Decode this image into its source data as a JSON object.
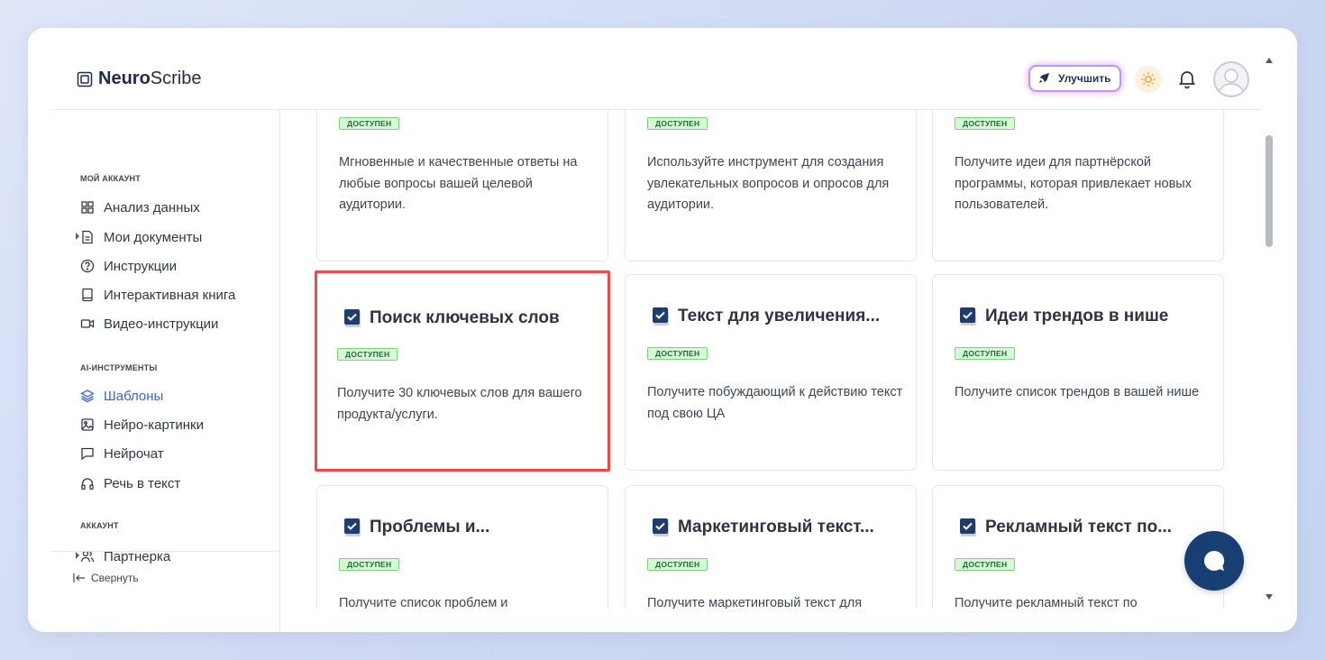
{
  "header": {
    "logo_bold": "Neuro",
    "logo_rest": "Scribe",
    "upgrade_label": "Улучшить"
  },
  "sidebar": {
    "sections": [
      {
        "title": "МОЙ АККАУНТ"
      },
      {
        "title": "AI-ИНСТРУМЕНТЫ"
      },
      {
        "title": "АККАУНТ"
      }
    ],
    "items": [
      {
        "label": "Анализ данных",
        "icon": "grid-icon"
      },
      {
        "label": "Мои документы",
        "icon": "document-icon"
      },
      {
        "label": "Инструкции",
        "icon": "help-circle-icon"
      },
      {
        "label": "Интерактивная книга",
        "icon": "book-icon"
      },
      {
        "label": "Видео-инструкции",
        "icon": "video-icon"
      },
      {
        "label": "Шаблоны",
        "icon": "layers-icon",
        "active": true
      },
      {
        "label": "Нейро-картинки",
        "icon": "image-icon"
      },
      {
        "label": "Нейрочат",
        "icon": "chat-icon"
      },
      {
        "label": "Речь в текст",
        "icon": "headphones-icon"
      },
      {
        "label": "Партнерка",
        "icon": "users-icon"
      }
    ],
    "collapse_label": "Свернуть"
  },
  "cards": [
    {
      "title": "",
      "badge": "ДОСТУПЕН",
      "desc": "Мгновенные и качественные ответы на любые вопросы вашей целевой аудитории."
    },
    {
      "title": "",
      "badge": "ДОСТУПЕН",
      "desc": "Используйте инструмент для создания увлекательных вопросов и опросов для аудитории."
    },
    {
      "title": "",
      "badge": "ДОСТУПЕН",
      "desc": "Получите идеи для партнёрской программы, которая привлекает новых пользователей."
    },
    {
      "title": "Поиск ключевых слов",
      "badge": "ДОСТУПЕН",
      "desc": "Получите 30 ключевых слов для вашего продукта/услуги.",
      "highlighted": true
    },
    {
      "title": "Текст для увеличения...",
      "badge": "ДОСТУПЕН",
      "desc": "Получите побуждающий к действию текст под свою ЦА"
    },
    {
      "title": "Идеи трендов в нише",
      "badge": "ДОСТУПЕН",
      "desc": "Получите список трендов в вашей нише"
    },
    {
      "title": "Проблемы и...",
      "badge": "ДОСТУПЕН",
      "desc": "Получите список проблем и"
    },
    {
      "title": "Маркетинговый текст...",
      "badge": "ДОСТУПЕН",
      "desc": "Получите маркетинговый текст для"
    },
    {
      "title": "Рекламный текст по...",
      "badge": "ДОСТУПЕН",
      "desc": "Получите рекламный текст по"
    }
  ],
  "colors": {
    "accent": "#3f63cf",
    "badge_bg": "#d7f8d4",
    "highlight": "#ef4750",
    "chat_button": "#183f73"
  }
}
